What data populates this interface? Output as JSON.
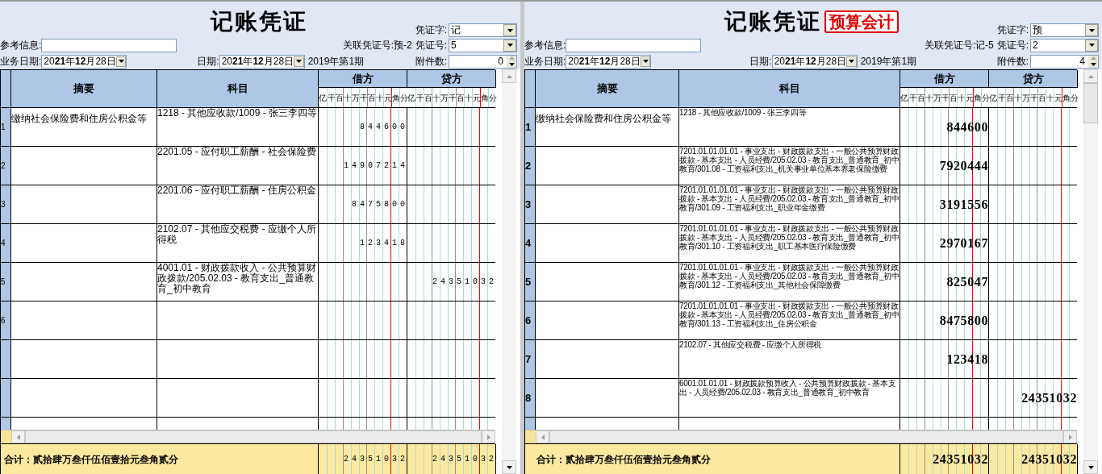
{
  "vouchers": [
    {
      "title": "记账凭证",
      "fields": {
        "word_label": "凭证字:",
        "word_value": "记",
        "ref_label": "参考信息:",
        "link_label": "关联凭证号:预-2",
        "number_label": "凭证号:",
        "number_value": "5",
        "biz_date_label": "业务日期:",
        "biz_date": "20**21**年**12**月28日",
        "date_label": "日期:",
        "date": "20**21**年**12**月28日",
        "period": "2019年第1期",
        "attach_label": "附件数:",
        "attach_value": "0"
      },
      "columns": {
        "summary": "摘要",
        "account": "科目",
        "debit": "借方",
        "credit": "贷方",
        "debit_units": [
          "亿",
          "千",
          "百",
          "十",
          "万",
          "千",
          "百",
          "十",
          "元",
          "角",
          "分"
        ],
        "credit_units": [
          "亿",
          "千",
          "百",
          "十",
          "万",
          "千",
          "百",
          "十",
          "元",
          "角",
          "分"
        ]
      },
      "rows": [
        {
          "number": "1",
          "summary": "缴纳社会保险费和住房公积金等",
          "account": "1218 - 其他应收款/1009 - 张三李四等",
          "debit": "844600"
        },
        {
          "number": "2",
          "account": "2201.05 - 应付职工薪酬 - 社会保险费",
          "debit": "14907214"
        },
        {
          "number": "3",
          "account": "2201.06 - 应付职工薪酬 - 住房公积金",
          "debit": "8475800"
        },
        {
          "number": "4",
          "account": "2102.07 - 其他应交税费 - 应缴个人所得税",
          "debit": "123418"
        },
        {
          "number": "5",
          "account": "4001.01 - 财政拨款收入 - 公共预算财政拨款/205.02.03 - 教育支出_普通教育_初中教育",
          "credit": "24351032"
        },
        {
          "number": "6"
        }
      ],
      "total": {
        "label": "合计：贰拾肆万叁仟伍佰壹拾元叁角贰分",
        "debit": "24351032",
        "credit": "24351032"
      }
    },
    {
      "title": "记账凭证",
      "badge": "预算会计",
      "fields": {
        "word_label": "凭证字:",
        "word_value": "预",
        "ref_label": "参考信息:",
        "link_label": "关联凭证号:记-5",
        "number_label": "凭证号:",
        "number_value": "2",
        "biz_date_label": "业务日期:",
        "biz_date": "20**21**年**12**月28日",
        "date_label": "日期:",
        "date": "20**21**年**12**月28日",
        "period": "2019年第1期",
        "attach_label": "附件数:",
        "attach_value": "4"
      },
      "columns": {
        "summary": "摘要",
        "account": "科目",
        "debit": "借方",
        "credit": "贷方",
        "debit_units": [
          "亿",
          "千",
          "百",
          "十",
          "万",
          "千",
          "百",
          "十",
          "元",
          "角",
          "分"
        ],
        "credit_units": [
          "亿",
          "千",
          "百",
          "十",
          "万",
          "千",
          "百",
          "十",
          "元",
          "角",
          "分"
        ]
      },
      "rows": [
        {
          "number": "1",
          "summary": "缴纳社会保险费和住房公积金等",
          "account": "1218 - 其他应收款/1009 - 张三李四等",
          "debit": "844600"
        },
        {
          "number": "2",
          "account": "7201.01.01.01.01 - 事业支出 - 财政拨款支出 - 一般公共预算财政拨款 - 基本支出 - 人员经费/205.02.03 - 教育支出_普通教育_初中教育/301.08 - 工资福利支出_机关事业单位基本养老保险缴费",
          "debit": "7920444"
        },
        {
          "number": "3",
          "account": "7201.01.01.01.01 - 事业支出 - 财政拨款支出 - 一般公共预算财政拨款 - 基本支出 - 人员经费/205.02.03 - 教育支出_普通教育_初中教育/301.09 - 工资福利支出_职业年金缴费",
          "debit": "3191556"
        },
        {
          "number": "4",
          "account": "7201.01.01.01.01 - 事业支出 - 财政拨款支出 - 一般公共预算财政拨款 - 基本支出 - 人员经费/205.02.03 - 教育支出_普通教育_初中教育/301.10 - 工资福利支出_职工基本医疗保险缴费",
          "debit": "2970167"
        },
        {
          "number": "5",
          "account": "7201.01.01.01.01 - 事业支出 - 财政拨款支出 - 一般公共预算财政拨款 - 基本支出 - 人员经费/205.02.03 - 教育支出_普通教育_初中教育/301.12 - 工资福利支出_其他社会保障缴费",
          "debit": "825047"
        },
        {
          "number": "6",
          "account": "7201.01.01.01.01 - 事业支出 - 财政拨款支出 - 一般公共预算财政拨款 - 基本支出 - 人员经费/205.02.03 - 教育支出_普通教育_初中教育/301.13 - 工资福利支出_住房公积金",
          "debit": "8475800"
        },
        {
          "number": "7",
          "account": "2102.07 - 其他应交税费 - 应缴个人所得税",
          "debit": "123418"
        },
        {
          "number": "8",
          "account": "6001.01.01.01 - 财政拨款预算收入 - 公共预算财政拨款 - 基本支出 - 人员经费/205.02.03 - 教育支出_普通教育_初中教育",
          "credit": "24351032"
        }
      ],
      "total": {
        "label": "合计：贰拾肆万叁仟伍佰壹拾元叁角贰分",
        "debit": "24351032",
        "credit": "24351032"
      }
    }
  ]
}
